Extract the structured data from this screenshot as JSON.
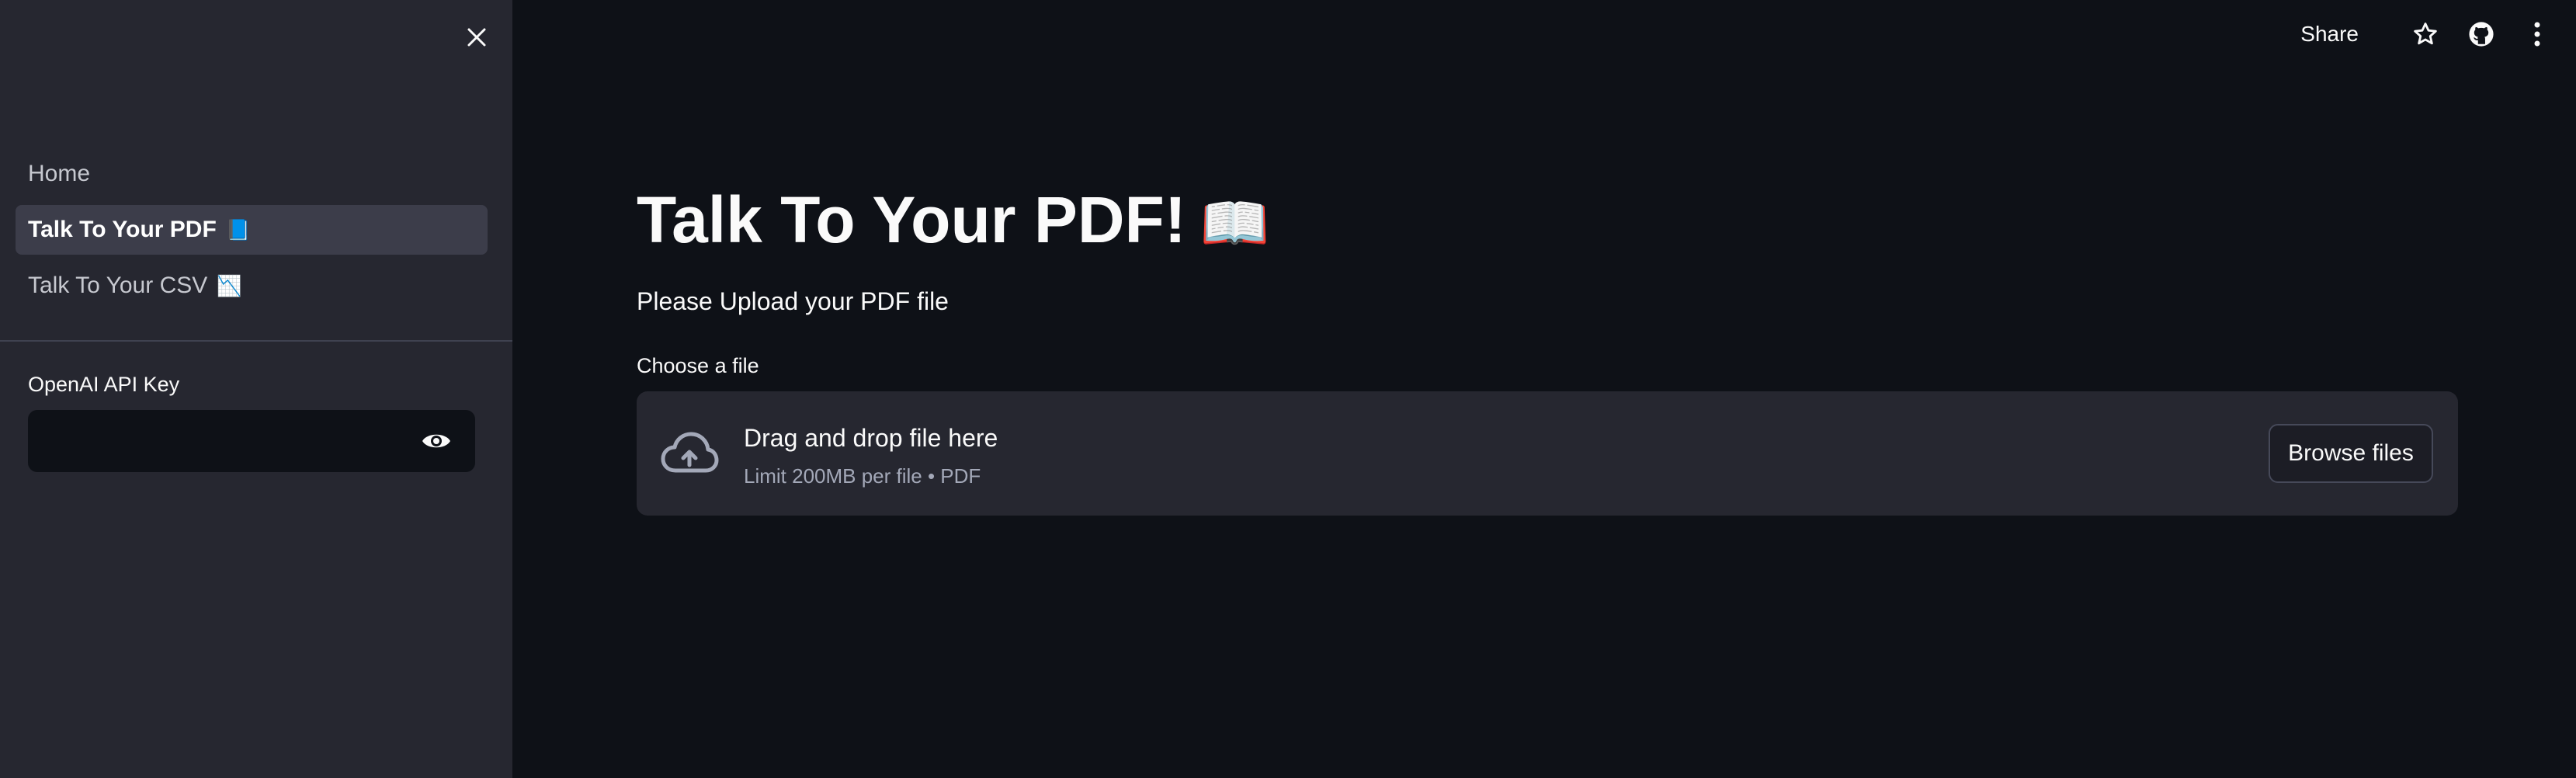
{
  "sidebar": {
    "close_icon": "close-icon",
    "nav": [
      {
        "label": "Home",
        "emoji": ""
      },
      {
        "label": "Talk To Your PDF",
        "emoji": "📘",
        "active": true
      },
      {
        "label": "Talk To Your CSV",
        "emoji": "📉"
      }
    ],
    "api_key": {
      "label": "OpenAI API Key",
      "value": "",
      "toggle_icon": "eye-icon"
    }
  },
  "toolbar": {
    "share_label": "Share",
    "icons": [
      "star-icon",
      "github-icon",
      "more-vertical-icon"
    ]
  },
  "main": {
    "title": "Talk To Your PDF!",
    "title_emoji": "📖",
    "subtitle": "Please Upload your PDF file",
    "uploader": {
      "label": "Choose a file",
      "drop_text": "Drag and drop file here",
      "limit_text": "Limit 200MB per file • PDF",
      "browse_label": "Browse files",
      "icon": "cloud-upload-icon"
    }
  },
  "colors": {
    "background": "#0e1117",
    "sidebar": "#262730",
    "text": "#fafafa"
  }
}
